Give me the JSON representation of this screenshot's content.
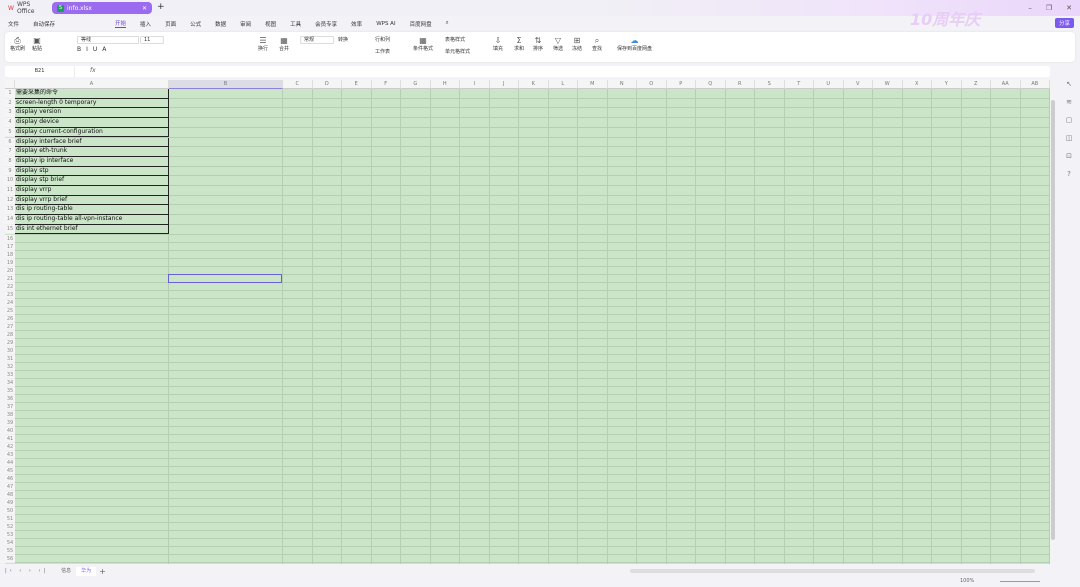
{
  "titlebar": {
    "home_tab": "WPS Office",
    "doc_tab": "info.xlsx",
    "doc_icon": "S",
    "anniversary": "10周年庆"
  },
  "menu": {
    "file": "文件",
    "autosave": "自动保存",
    "tabs": [
      "开始",
      "插入",
      "页面",
      "公式",
      "数据",
      "审阅",
      "视图",
      "工具",
      "会员专享",
      "效率",
      "WPS AI",
      "百度网盘"
    ],
    "active": 0,
    "share": "分享"
  },
  "ribbon": {
    "format_painter": "格式刷",
    "paste": "粘贴",
    "font": "等线",
    "font_size": "11",
    "wrap": "换行",
    "merge": "合并",
    "number_format": "常规",
    "convert": "转换",
    "row_col": "行和列",
    "worksheet": "工作表",
    "cond_format": "条件格式",
    "table_style": "表格样式",
    "cell_style": "单元格样式",
    "fill": "填充",
    "sum": "求和",
    "sort": "排序",
    "filter": "筛选",
    "freeze": "冻结",
    "find": "查找",
    "save_baidu": "保存到百度网盘"
  },
  "formula_bar": {
    "name_box": "B21",
    "fx": "fx",
    "value": ""
  },
  "sheet": {
    "columns": [
      "A",
      "B",
      "C",
      "D",
      "E",
      "F",
      "G",
      "H",
      "I",
      "J",
      "K",
      "L",
      "M",
      "N",
      "O",
      "P",
      "Q",
      "R",
      "S",
      "T",
      "U",
      "V",
      "W",
      "X",
      "Y",
      "Z",
      "AA",
      "AB"
    ],
    "row_count": 56,
    "selected_cell": "B21",
    "cells_A": [
      "需要采集的命令",
      "screen-length 0 temporary",
      "display version",
      "display device",
      "display current-configuration",
      "display interface brief",
      "display eth-trunk",
      "display ip interface",
      "display stp",
      "display stp brief",
      "display vrrp",
      "display vrrp brief",
      "dis ip routing-table",
      "dis ip routing-table all-vpn-instance",
      "dis int ethernet brief"
    ]
  },
  "sheet_tabs": [
    "信息",
    "华为"
  ],
  "active_sheet": 1,
  "status": {
    "zoom": "100%"
  }
}
